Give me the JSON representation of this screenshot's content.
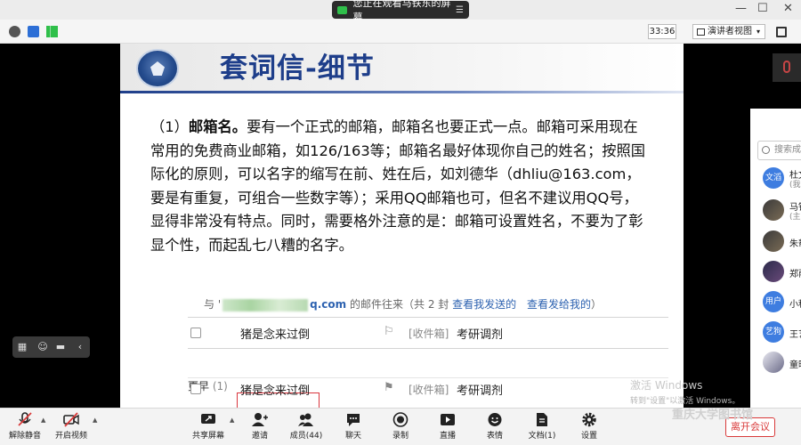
{
  "titlebar": {
    "share_notice": "您正在观看马铁东的屏幕",
    "minimize": "—",
    "maximize": "☐",
    "close": "✕"
  },
  "infobar": {
    "timer": "33:36",
    "speaker_view_label": "演讲者视图"
  },
  "slide": {
    "title": "套词信-细节",
    "point_label": "（1）",
    "point_bold": "邮箱名。",
    "point_text": "要有一个正式的邮箱，邮箱名也要正式一点。邮箱可采用现在常用的免费商业邮箱，如126/163等；邮箱名最好体现你自己的姓名；按照国际化的原则，可以名字的缩写在前、姓在后，如刘德华（dhliu@163.com，要是有重复，可组合一些数字等）；采用QQ邮箱也可，但名不建议用QQ号，显得非常没有特点。同时，需要格外注意的是：邮箱可设置姓名，不要为了彰显个性，而起乱七八糟的名字。"
  },
  "mail": {
    "prefix": "与",
    "partial_char": "'",
    "domain_suffix": "q.com",
    "header_text": "的邮件往来（共 2 封",
    "link_sent": "查看我发送的",
    "link_received": "查看发给我的",
    "header_close": "）",
    "rows": [
      {
        "from": "猪是念来过倒",
        "flag": "⚐",
        "box": "[收件箱]",
        "subject": "考研调剂"
      },
      {
        "from": "猪是念来过倒",
        "flag": "⚑",
        "box": "[收件箱]",
        "subject": "考研调剂"
      }
    ],
    "earlier_label": "更早",
    "earlier_count": "(1)"
  },
  "panel": {
    "search_placeholder": "搜索成员",
    "participants": [
      {
        "avatar": "文滔",
        "name": "杜文",
        "sub": "(我)",
        "photo": false
      },
      {
        "avatar": "",
        "name": "马铁",
        "sub": "(主",
        "photo": true
      },
      {
        "avatar": "",
        "name": "朱帮",
        "sub": "",
        "photo": true
      },
      {
        "avatar": "",
        "name": "郑雨",
        "sub": "",
        "photo": true
      },
      {
        "avatar": "用户",
        "name": "小程",
        "sub": "",
        "photo": false
      },
      {
        "avatar": "艺狗",
        "name": "王艺",
        "sub": "",
        "photo": false
      },
      {
        "avatar": "",
        "name": "童晓",
        "sub": "",
        "photo": true
      }
    ]
  },
  "watermark": {
    "activate": "激活 Windows",
    "activate_sub": "转到\"设置\"以激活 Windows。",
    "university": "重庆大学图书馆"
  },
  "toolbar": {
    "unmute": "解除静音",
    "start_video": "开启视频",
    "share_screen": "共享屏幕",
    "invite": "邀请",
    "members": "成员(44)",
    "chat": "聊天",
    "record": "录制",
    "live": "直播",
    "reactions": "表情",
    "docs": "文档(1)",
    "settings": "设置",
    "leave": "离开会议"
  },
  "colors": {
    "slide_title": "#1e3e8a",
    "link_blue": "#2d62b0",
    "leave_red": "#d93a3a",
    "avatar_blue": "#3e7de0"
  }
}
